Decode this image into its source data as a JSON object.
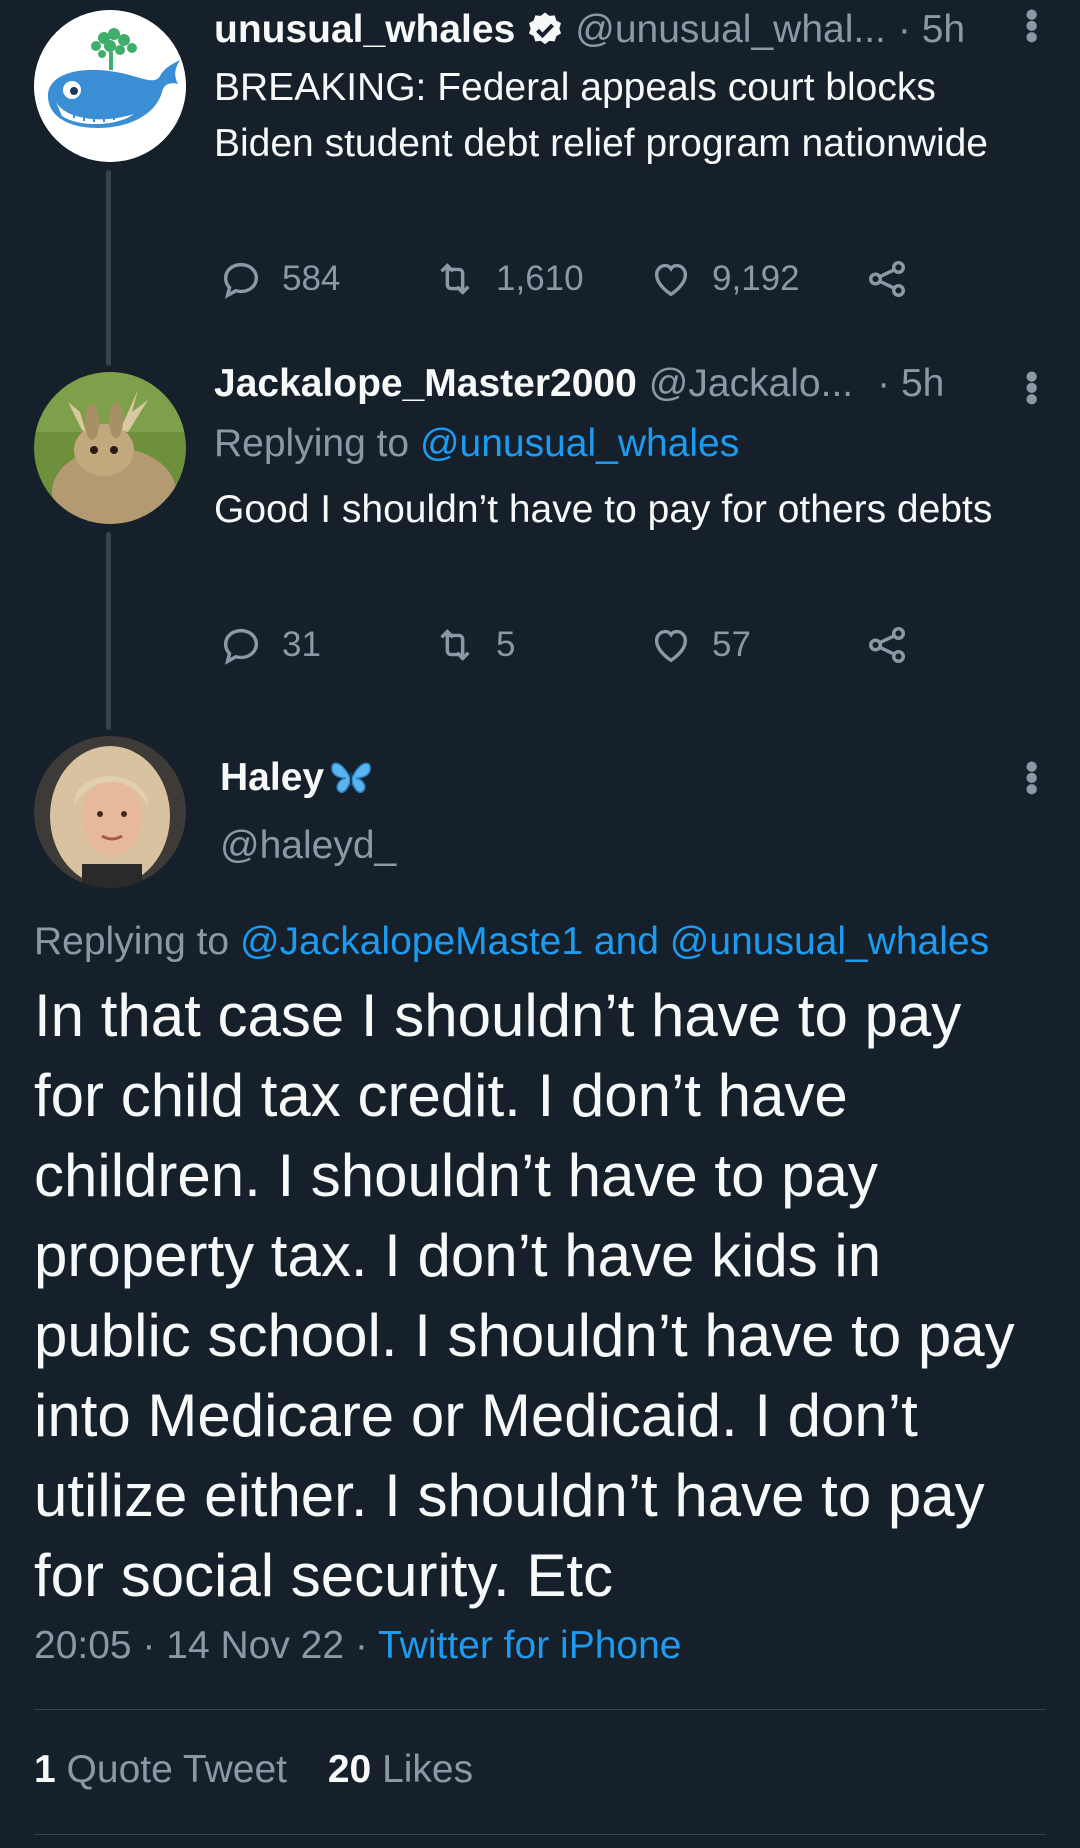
{
  "tweet1": {
    "name": "unusual_whales",
    "handle": "@unusual_whal...",
    "time": "· 5h",
    "text": "BREAKING: Federal appeals court blocks Biden student debt relief program nationwide",
    "replies": "584",
    "retweets": "1,610",
    "likes": "9,192"
  },
  "tweet2": {
    "name": "Jackalope_Master2000",
    "handle": "@Jackalo...",
    "time": "· 5h",
    "replying_prefix": "Replying to ",
    "replying_to": "@unusual_whales",
    "text": "Good I shouldn’t have to pay for others debts",
    "replies": "31",
    "retweets": "5",
    "likes": "57"
  },
  "main_tweet": {
    "name": "Haley",
    "handle": "@haleyd_",
    "replying_prefix": "Replying to ",
    "replying_to": "@JackalopeMaste1 and @unusual_whales",
    "text": "In that case I shouldn’t have to pay for child tax credit. I don’t have children. I shouldn’t have to pay property tax. I don’t have kids in public school. I shouldn’t have to pay into Medicare or Medicaid. I don’t utilize either. I shouldn’t have to pay for social security. Etc",
    "timestamp": "20:05 · 14 Nov 22 · ",
    "source": "Twitter for iPhone",
    "quote_count": "1",
    "quote_label": "Quote Tweet",
    "like_count": "20",
    "like_label": "Likes"
  },
  "icons": {
    "verified": "verified-badge-icon",
    "butterfly": "butterfly-emoji-icon",
    "reply": "reply-icon",
    "retweet": "retweet-icon",
    "like": "heart-icon",
    "share": "share-icon",
    "more": "more-vertical-icon"
  },
  "colors": {
    "background": "#15202b",
    "link": "#1d9bf0",
    "muted": "#8b98a5",
    "text": "#f7f9f9"
  }
}
